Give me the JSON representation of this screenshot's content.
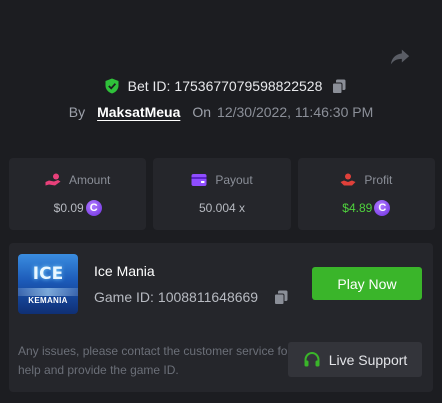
{
  "header": {
    "bet_id_label": "Bet ID:",
    "bet_id_value": "1753677079598822528",
    "by_label": "By",
    "username": "MaksatMeua",
    "on_label": "On",
    "datetime": "12/30/2022, 11:46:30 PM"
  },
  "stats": {
    "amount": {
      "label": "Amount",
      "value": "$0.09",
      "icon": "coins-hand-icon",
      "color": "#e8407a"
    },
    "payout": {
      "label": "Payout",
      "value": "50.004 x",
      "icon": "wallet-icon",
      "color": "#8f4dff"
    },
    "profit": {
      "label": "Profit",
      "value": "$4.89",
      "icon": "profit-hand-icon",
      "color": "#e0403a",
      "value_color": "#4fd23d"
    }
  },
  "currency_symbol": "C",
  "game": {
    "thumbnail_title": "ICE",
    "thumbnail_subtitle": "KEMANIA",
    "name": "Ice Mania",
    "id_label": "Game ID:",
    "id_value": "1008811648669",
    "play_label": "Play Now",
    "issue_text": "Any issues, please contact the customer service for help and provide the game ID.",
    "support_label": "Live Support"
  },
  "colors": {
    "background": "#1c1d21",
    "card": "#25262b",
    "accent_green": "#3ab52a",
    "shield_green": "#2fc13a"
  }
}
